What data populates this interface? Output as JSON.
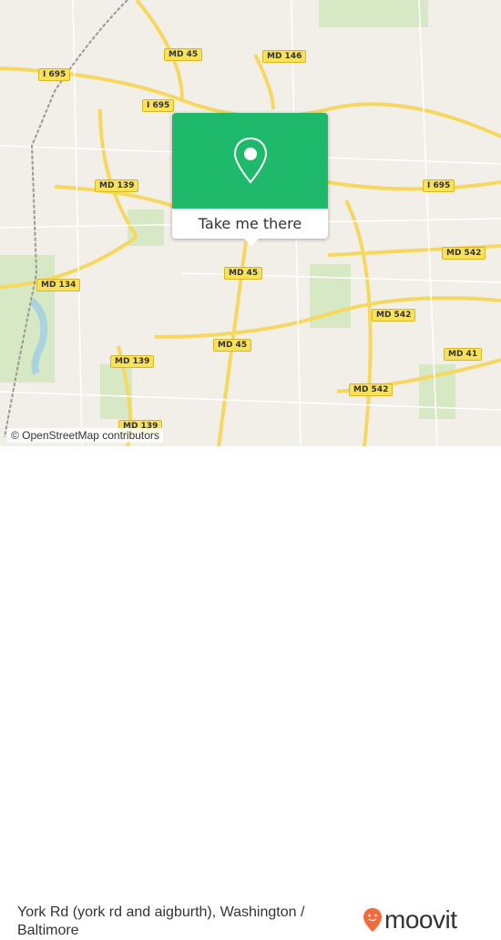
{
  "map": {
    "road_labels": [
      "MD 45",
      "MD 146",
      "I 695",
      "I 695",
      "MD 139",
      "I 695",
      "MD 542",
      "MD 45",
      "MD 134",
      "MD 542",
      "MD 45",
      "MD 139",
      "MD 41",
      "MD 542",
      "MD 139"
    ],
    "attribution": "© OpenStreetMap contributors"
  },
  "popup": {
    "icon": "map-pin-icon",
    "button_label": "Take me there",
    "color": "#1fb96b"
  },
  "footer": {
    "title": "York Rd (york rd and aigburth), Washington / Baltimore",
    "logo_text": "moovit",
    "brand_color": "#f26b3a"
  }
}
